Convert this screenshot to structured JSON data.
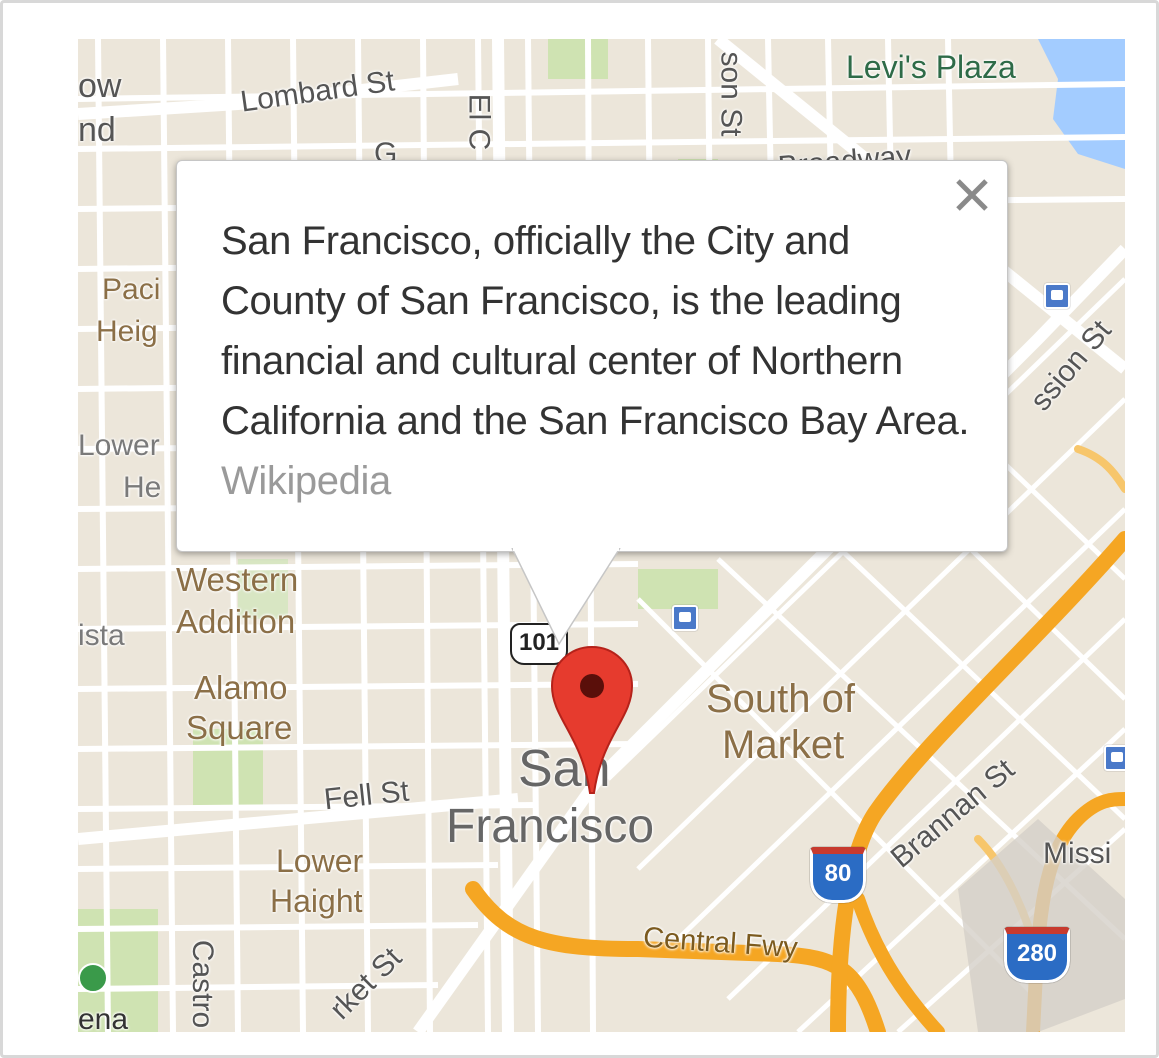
{
  "map": {
    "labels": {
      "lombard": "Lombard St",
      "levis_plaza": "Levi's Plaza",
      "broadway": "Broadway",
      "el_camino": "El C",
      "son_st": "son St",
      "pacific_heights": "Paci",
      "pacific_heights_2": "Heig",
      "lower_heights_1": "Lower",
      "lower_heights_2": "He",
      "western_addition_1": "Western",
      "western_addition_2": "Addition",
      "vista": "ista",
      "alamo_1": "Alamo",
      "alamo_2": "Square",
      "fell": "Fell St",
      "lower_haight_1": "Lower",
      "lower_haight_2": "Haight",
      "castro": "Castro",
      "market": "rket St",
      "ena": "ena",
      "som_1": "South of",
      "som_2": "Market",
      "city_1": "San",
      "city_2": "Francisco",
      "brannan": "Brannan St",
      "mission_st": "ssion St",
      "missi": "Missi",
      "central_fwy": "Central Fwy",
      "ow": "ow",
      "nd": "nd",
      "g": "G"
    },
    "shields": {
      "us101": "101",
      "i80": "80",
      "i280": "280"
    },
    "colors": {
      "land": "#ece6da",
      "road": "#ffffff",
      "freeway": "#f5a623",
      "park": "#cfe3b2",
      "water": "#a3ccff",
      "marker": "#e63b2e"
    }
  },
  "popup": {
    "description": "San Francisco, officially the City and County of San Francisco, is the leading financial and cultural center of Northern California and the San Francisco Bay Area.",
    "source_link": "Wikipedia",
    "close_icon": "close-icon"
  },
  "marker": {
    "icon": "map-pin-icon"
  }
}
